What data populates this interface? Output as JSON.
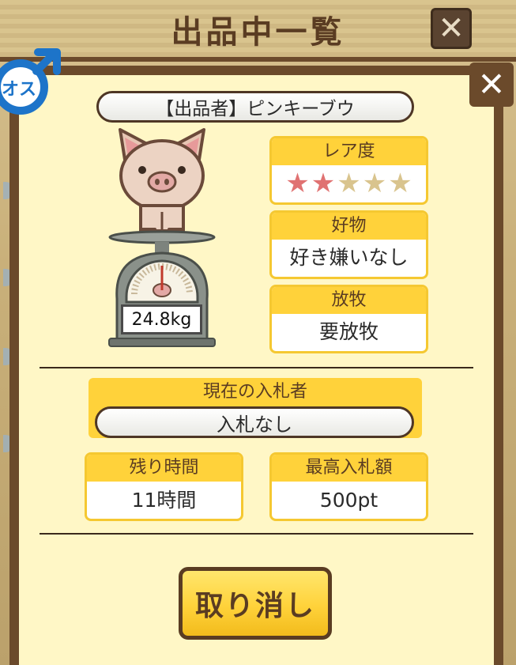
{
  "background_window": {
    "title": "出品中一覧",
    "close_symbol": "✕"
  },
  "dialog": {
    "close_symbol": "✕",
    "gender_badge": {
      "icon": "male-symbol-icon",
      "label": "オス",
      "color": "#1d74c9"
    },
    "seller_label": "【出品者】ピンキーブウ",
    "pig": {
      "icon": "pig-on-scale-illustration",
      "weight": "24.8kg"
    },
    "rarity": {
      "label": "レア度",
      "stars_filled": 2,
      "stars_total": 5,
      "stars": [
        "★",
        "★",
        "★",
        "★",
        "★"
      ]
    },
    "favorite_food": {
      "label": "好物",
      "value": "好き嫌いなし"
    },
    "grazing": {
      "label": "放牧",
      "value": "要放牧"
    },
    "current_bidder": {
      "label": "現在の入札者",
      "value": "入札なし"
    },
    "time_left": {
      "label": "残り時間",
      "value": "11時間"
    },
    "highest_bid": {
      "label": "最高入札額",
      "value": "500pt"
    },
    "cancel_button": "取り消し"
  },
  "colors": {
    "dialog_bg": "#fff7c6",
    "frame_brown": "#6b4a2b",
    "accent_yellow": "#ffd23a",
    "star_on": "#e07272",
    "star_off": "#d9c48e"
  }
}
